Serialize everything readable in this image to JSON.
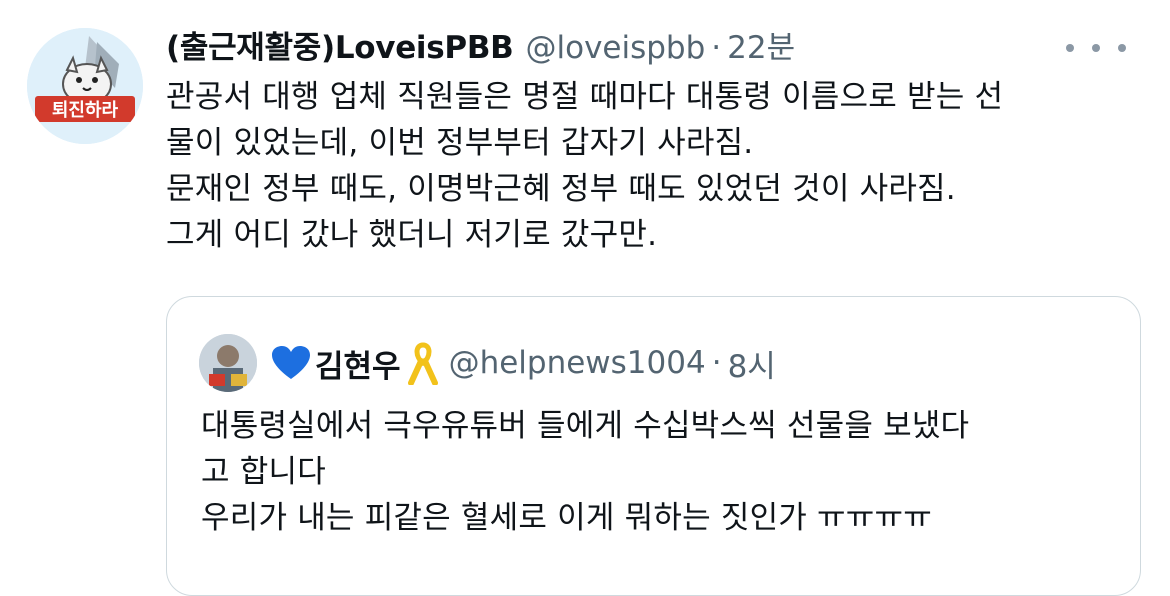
{
  "tweet": {
    "display_name": "(출근재활중)LoveisPBB",
    "handle": "@loveispbb",
    "separator": "·",
    "time": "22분",
    "avatar_text": "퇴진하라",
    "lines": [
      "관공서 대행 업체 직원들은 명절 때마다 대통령 이름으로 받는 선",
      "물이 있었는데, 이번 정부부터 갑자기 사라짐.",
      "문재인 정부 때도, 이명박근혜 정부 때도 있었던 것이 사라짐.",
      "그게 어디 갔나 했더니 저기로 갔구만."
    ]
  },
  "quoted_tweet": {
    "display_name": "김현우",
    "handle": "@helpnews1004",
    "separator": "·",
    "time": "8시",
    "lines": [
      "대통령실에서 극우유튜버 들에게 수십박스씩 선물을 보냈다",
      "고 합니다",
      "우리가 내는 피같은 혈세로 이게 뭐하는 짓인가 ㅠㅠㅠㅠ"
    ]
  },
  "colors": {
    "text": "#0f1419",
    "secondary": "#536471",
    "border": "#cfd9de",
    "avatar_banner": "#d23a2c",
    "blue_heart": "#1d6fe0",
    "yellow_ribbon": "#f2c21b"
  }
}
